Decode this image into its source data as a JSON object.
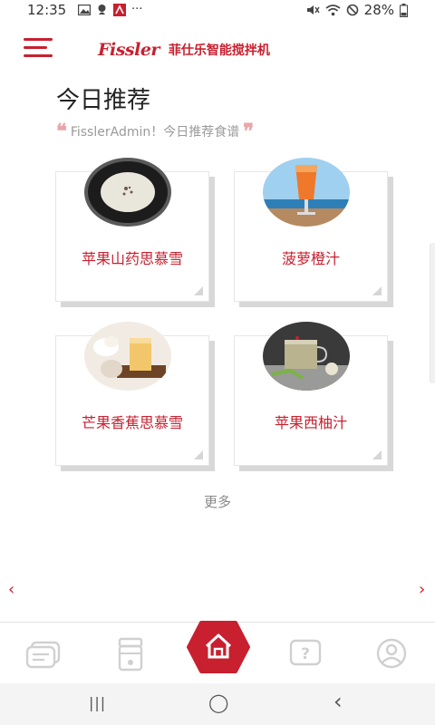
{
  "status_bar": {
    "time": "12:35",
    "left_icons": [
      "image-icon",
      "notification-icon",
      "app-icon",
      "more-dots-icon"
    ],
    "more_dots": "···",
    "battery": "28%",
    "right_icons": [
      "mute-icon",
      "wifi-icon",
      "dnd-icon",
      "battery-icon"
    ]
  },
  "header": {
    "logo_text": "Fissler",
    "app_name": "菲仕乐智能搅拌机"
  },
  "main": {
    "title": "今日推荐",
    "subtitle": "FisslerAdmin！今日推荐食谱",
    "quote_open": "❝",
    "quote_close": "❞",
    "recipes": [
      {
        "name": "苹果山药思慕雪",
        "photo": "white-smoothie-bowl"
      },
      {
        "name": "菠萝橙汁",
        "photo": "orange-juice-glass"
      },
      {
        "name": "芒果香蕉思慕雪",
        "photo": "mango-smoothie-glass"
      },
      {
        "name": "苹果西柚汁",
        "photo": "apple-juice-cup"
      }
    ],
    "more_label": "更多",
    "prev_arrow": "‹",
    "next_arrow": "›"
  },
  "bottom_nav": {
    "items": [
      {
        "name": "recipes-icon"
      },
      {
        "name": "blender-icon"
      },
      {
        "name": "home-icon"
      },
      {
        "name": "help-icon"
      },
      {
        "name": "profile-icon"
      }
    ]
  },
  "system_nav": {
    "recents": "|||",
    "home": "◯",
    "back": "‹"
  },
  "colors": {
    "accent": "#c8202f",
    "card_shadow": "#d8d8d8",
    "muted_text": "#9a9a9a"
  }
}
